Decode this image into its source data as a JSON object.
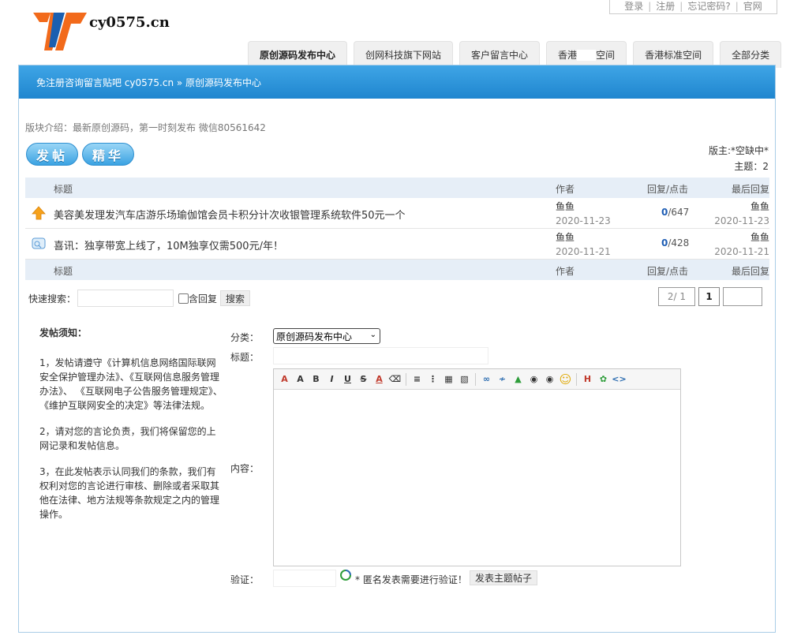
{
  "top_links": {
    "login": "登录",
    "register": "注册",
    "forgot": "忘记密码?",
    "official": "官网"
  },
  "logo": {
    "text": "cy0575.cn"
  },
  "nav_tabs": [
    "原创源码发布中心",
    "创网科技旗下网站",
    "客户留言中心",
    "香港",
    "空间",
    "香港标准空间",
    "全部分类"
  ],
  "breadcrumb": {
    "text": "免注册咨询留言贴吧 cy0575.cn » 原创源码发布中心"
  },
  "board": {
    "intro": "版块介绍：最新原创源码，第一时刻发布 微信80561642",
    "post_button": "发帖",
    "elite_button": "精华",
    "moderator": "版主:*空缺中*",
    "topic_count": "主题：2"
  },
  "table": {
    "headers": {
      "title": "标题",
      "author": "作者",
      "reply": "回复/点击",
      "last": "最后回复"
    },
    "rows": [
      {
        "icon": "up-arrow-icon",
        "title": "美容美发理发汽车店游乐场瑜伽馆会员卡积分计次收银管理系统软件50元一个",
        "author": "鱼鱼",
        "date": "2020-11-23",
        "replies": "0",
        "clicks": "/647",
        "last_user": "鱼鱼",
        "last_date": "2020-11-23"
      },
      {
        "icon": "chat-bubble-icon",
        "title": "喜讯：独享带宽上线了，10M独享仅需500元/年！",
        "author": "鱼鱼",
        "date": "2020-11-21",
        "replies": "0",
        "clicks": "/428",
        "last_user": "鱼鱼",
        "last_date": "2020-11-21"
      }
    ]
  },
  "search": {
    "label": "快速搜索：",
    "include_reply": "含回复",
    "button": "搜索"
  },
  "pager": {
    "info": "2/ 1",
    "current": "1"
  },
  "rules": {
    "title": "发帖须知：",
    "items": [
      "1，发帖请遵守《计算机信息网络国际联网安全保护管理办法》、《互联网信息服务管理办法》、 《互联网电子公告服务管理规定》、《维护互联网安全的决定》等法律法规。",
      "2，请对您的言论负责，我们将保留您的上网记录和发帖信息。",
      "3，在此发帖表示认同我们的条款，我们有权利对您的言论进行审核、删除或者采取其他在法律、地方法规等条款规定之内的管理操作。"
    ]
  },
  "form": {
    "category_label": "分类：",
    "category_value": "原创源码发布中心",
    "title_label": "标题：",
    "content_label": "内容：",
    "verify_label": "验证：",
    "verify_note": "* 匿名发表需要进行验证！",
    "submit": "发表主题帖子"
  }
}
